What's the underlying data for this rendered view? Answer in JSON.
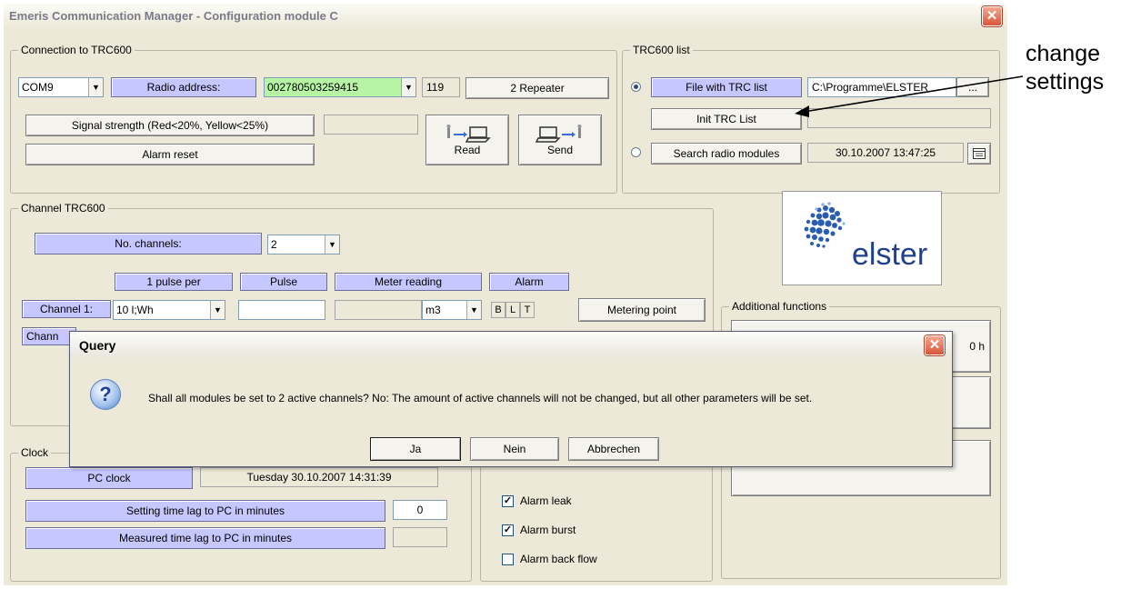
{
  "window": {
    "title": "Emeris Communication Manager - Configuration module C",
    "close": "✕"
  },
  "connection": {
    "label": "Connection to TRC600",
    "com_port": "COM9",
    "radio_address_label": "Radio address:",
    "radio_address": "002780503259415",
    "code": "119",
    "repeater_button": "2 Repeater",
    "signal_strength_button": "Signal strength (Red<20%, Yellow<25%)",
    "alarm_reset_button": "Alarm reset",
    "read_button": "Read",
    "send_button": "Send"
  },
  "trc_list": {
    "label": "TRC600 list",
    "file_button": "File with TRC list",
    "file_path": "C:\\Programme\\ELSTER",
    "browse_button": "...",
    "init_button": "Init TRC List",
    "search_button": "Search radio modules",
    "timestamp": "30.10.2007 13:47:25"
  },
  "channel": {
    "label": "Channel TRC600",
    "num_channels_label": "No. channels:",
    "num_channels_value": "2",
    "headers": {
      "pulse_per": "1 pulse per",
      "pulse": "Pulse",
      "meter_reading": "Meter reading",
      "alarm": "Alarm"
    },
    "channel1_label": "Channel 1:",
    "channel1_unit": "10 l;Wh",
    "channel1_meter_unit": "m3",
    "alarm_letters": [
      "B",
      "L",
      "T"
    ],
    "metering_point_button": "Metering point",
    "channel2_label_partial": "Chann"
  },
  "logo": {
    "brand": "elster"
  },
  "additional": {
    "label": "Additional functions",
    "partial_text": "0 h"
  },
  "clock": {
    "label": "Clock",
    "pc_clock_label": "PC clock",
    "pc_clock_value": "Tuesday   30.10.2007 14:31:39",
    "setting_lag_label": "Setting time lag to PC in minutes",
    "setting_lag_value": "0",
    "measured_lag_label": "Measured time lag to PC in minutes",
    "measured_lag_value": ""
  },
  "alarms": {
    "leak": "Alarm leak",
    "burst": "Alarm burst",
    "back_flow": "Alarm back flow",
    "leak_checked": true,
    "burst_checked": true,
    "back_flow_checked": false
  },
  "dialog": {
    "title": "Query",
    "message": "Shall all modules be set to 2 active channels? No: The amount of active channels will not be changed, but all other parameters will be set.",
    "yes_button": "Ja",
    "no_button": "Nein",
    "cancel_button": "Abbrechen",
    "icon": "?"
  },
  "annotation": {
    "line1": "change",
    "line2": "settings"
  },
  "colors": {
    "label_bg": "#c7c7ff",
    "address_bg": "#b7f5a4",
    "close_red": "#d8553a"
  }
}
